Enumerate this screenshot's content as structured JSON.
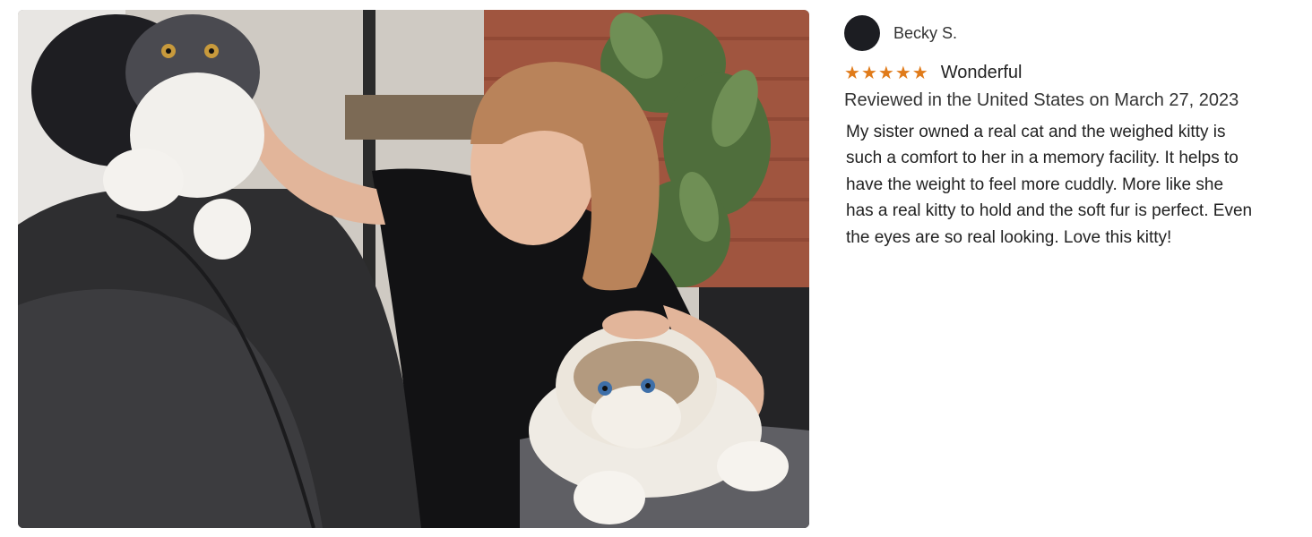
{
  "review": {
    "reviewer_name": "Becky S.",
    "rating": 5,
    "rating_max": 5,
    "star_color": "#e07b1a",
    "title": "Wonderful",
    "date_text": "Reviewed in the United States on March 27, 2023",
    "body": "My sister owned a real cat and the weighed kitty is such a comfort to her in a memory facility. It helps to have the weight to feel more cuddly. More like she has a real kitty to hold and the soft fur is perfect. Even the eyes are so real looking. Love this kitty!"
  },
  "photo": {
    "subject": "girl-with-plush-cats"
  }
}
